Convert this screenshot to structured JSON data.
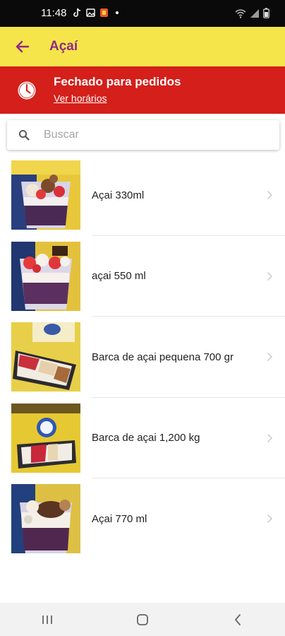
{
  "status_bar": {
    "time": "11:48"
  },
  "header": {
    "title": "Açaí",
    "back_icon": "arrow-left-icon"
  },
  "closed_banner": {
    "title": "Fechado para pedidos",
    "link": "Ver horários",
    "icon": "clock-icon"
  },
  "search": {
    "placeholder": "Buscar",
    "value": "",
    "icon": "search-icon"
  },
  "products": [
    {
      "name": "Açai 330ml"
    },
    {
      "name": "açai 550 ml"
    },
    {
      "name": "Barca de açai pequena 700 gr"
    },
    {
      "name": "Barca de açai 1,200 kg"
    },
    {
      "name": "Açai 770 ml"
    }
  ],
  "nav": {
    "recents_icon": "recents-icon",
    "home_icon": "home-icon",
    "back_icon": "back-chevron-icon"
  },
  "colors": {
    "status_bar": "#0a0a0a",
    "app_bar": "#f5e54a",
    "accent": "#8e2a86",
    "closed_banner": "#d41f1a",
    "nav_bar": "#f2f2f2"
  }
}
